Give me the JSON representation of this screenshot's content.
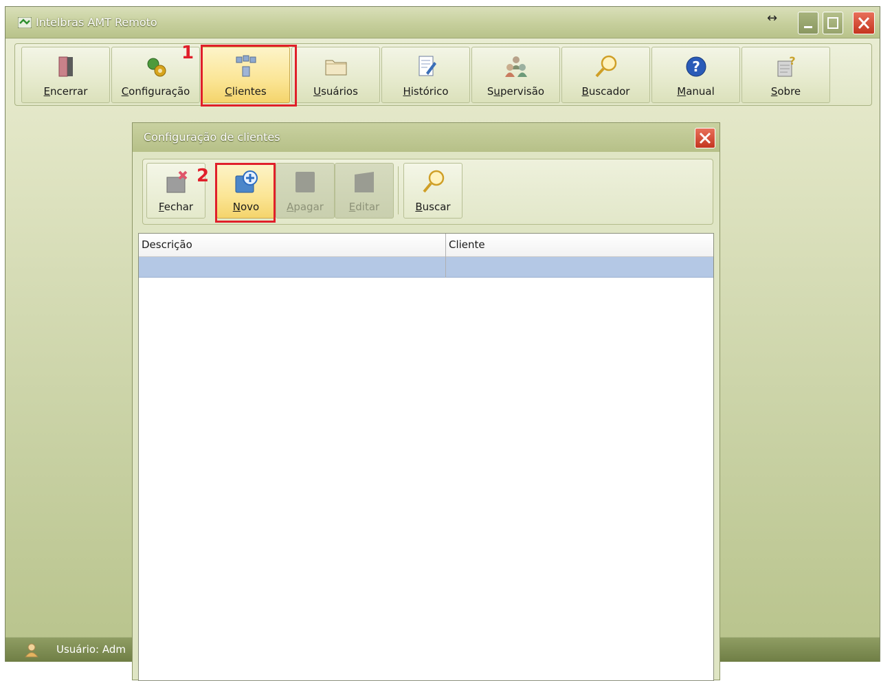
{
  "window": {
    "title": "Intelbras AMT Remoto"
  },
  "toolbar": {
    "items": [
      {
        "label": "Encerrar",
        "icon": "door-exit-icon"
      },
      {
        "label": "Configuração",
        "icon": "gears-config-icon"
      },
      {
        "label": "Clientes",
        "icon": "network-clients-icon",
        "active": true
      },
      {
        "label": "Usuários",
        "icon": "folder-icon"
      },
      {
        "label": "Histórico",
        "icon": "document-edit-icon"
      },
      {
        "label": "Supervisão",
        "icon": "users-group-icon"
      },
      {
        "label": "Buscador",
        "icon": "magnifier-icon"
      },
      {
        "label": "Manual",
        "icon": "help-icon"
      },
      {
        "label": "Sobre",
        "icon": "info-document-icon"
      }
    ]
  },
  "dialog": {
    "title": "Configuração de clientes",
    "buttons": [
      {
        "label": "Fechar",
        "icon": "close-document-icon",
        "enabled": true
      },
      {
        "label": "Novo",
        "icon": "add-new-icon",
        "enabled": true
      },
      {
        "label": "Apagar",
        "icon": "delete-icon",
        "enabled": false
      },
      {
        "label": "Editar",
        "icon": "edit-icon",
        "enabled": false
      },
      {
        "label": "Buscar",
        "icon": "magnifier-icon",
        "enabled": true
      }
    ],
    "grid": {
      "columns": [
        "Descrição",
        "Cliente"
      ],
      "rows": [
        [
          "",
          ""
        ]
      ]
    }
  },
  "statusbar": {
    "text": "Usuário: Adm"
  },
  "annotations": {
    "step1": "1",
    "step2": "2"
  },
  "colors": {
    "highlight": "#e01f2a",
    "selected_row": "#b4c8e5",
    "active_button": "#fbe595"
  }
}
